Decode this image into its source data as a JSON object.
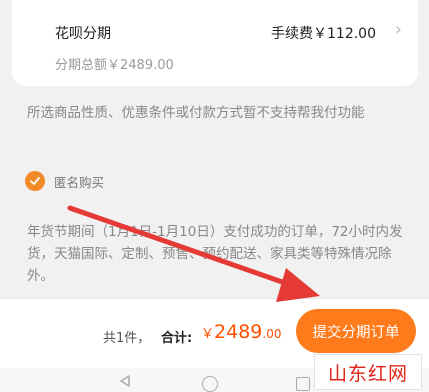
{
  "installment": {
    "title": "花呗分期",
    "fee": "手续费￥112.00",
    "total": "分期总额￥2489.00"
  },
  "notice_text": "所选商品性质、优惠条件或付款方式暂不支持帮我付功能",
  "anonymous_label": "匿名购买",
  "festival_text": "年货节期间（1月1日-1月10日）支付成功的订单，72小时内发货，天猫国际、定制、预售、预约配送、家具类等特殊情况除外。",
  "footer": {
    "count": "共1件，",
    "total_label": "合计:",
    "price_symbol": "￥",
    "price_int": "2489",
    "price_dec": ".00",
    "submit_label": "提交分期订单"
  },
  "watermark": "山东红网",
  "colors": {
    "accent": "#ff7a1a",
    "price": "#ff5000",
    "arrow": "#e53935"
  },
  "icons": [
    "check-icon",
    "chevron-right-icon",
    "back-nav-icon",
    "home-nav-icon",
    "recent-apps-icon"
  ]
}
